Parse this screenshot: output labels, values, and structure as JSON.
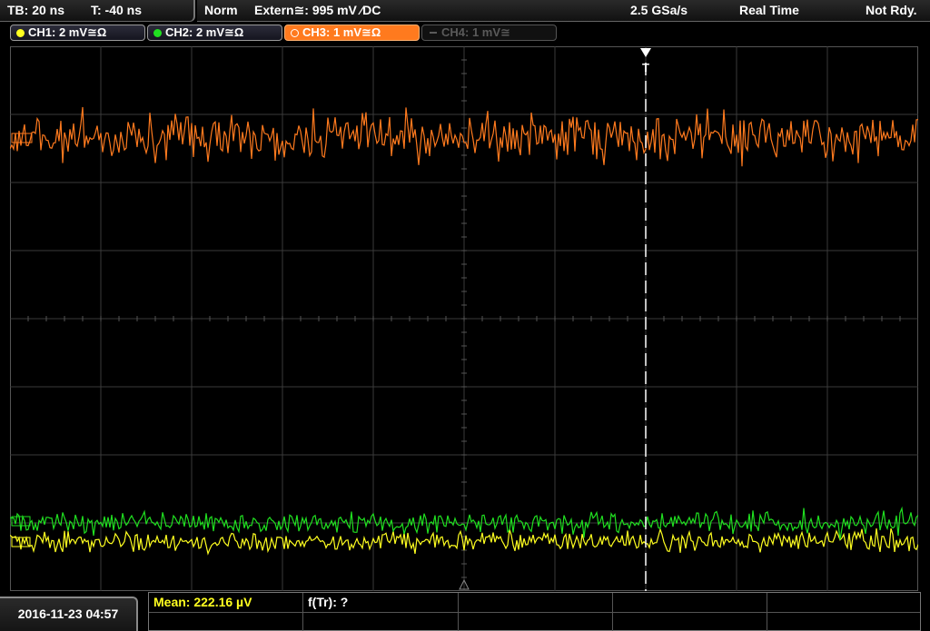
{
  "topbar": {
    "timebase": "TB: 20 ns",
    "trigger_time": "T: -40 ns",
    "trigger_mode": "Norm",
    "trigger_source": "Extern≅: 995 mV ⁄DC",
    "sample_rate": "2.5 GSa/s",
    "acq_mode": "Real Time",
    "status": "Not Rdy."
  },
  "channels": [
    {
      "label": "CH1: 2 mV≅Ω",
      "color": "#ffff20",
      "state": "on"
    },
    {
      "label": "CH2: 2 mV≅Ω",
      "color": "#20e020",
      "state": "on"
    },
    {
      "label": "CH3: 1 mV≅Ω",
      "color": "#ff7a1e",
      "state": "selected"
    },
    {
      "label": "CH4: 1 mV≅",
      "color": "#5a5a5a",
      "state": "off"
    }
  ],
  "bottombar": {
    "datetime": "2016-11-23 04:57",
    "meas1": "Mean: 222.16 µV",
    "meas2": "f(Tr): ?"
  },
  "colors": {
    "ch1": "#ffff20",
    "ch2": "#20e020",
    "ch3": "#ff7a1e",
    "grid": "#3a3a3a",
    "meas1": "#ffff20"
  }
}
